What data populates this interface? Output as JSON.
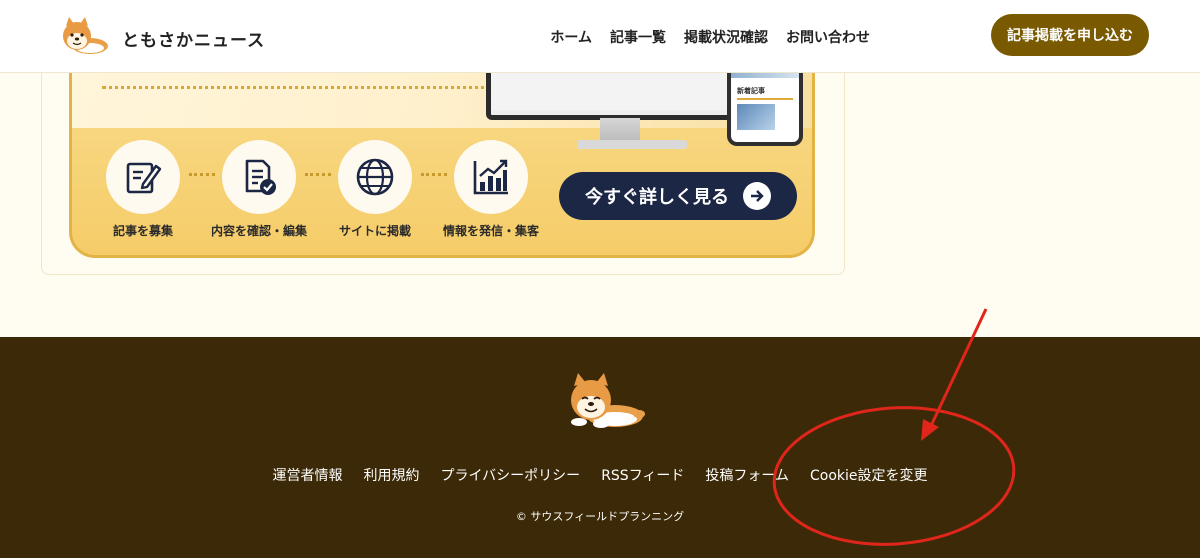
{
  "header": {
    "site_title": "ともさかニュース",
    "nav": [
      "ホーム",
      "記事一覧",
      "掲載状況確認",
      "お問い合わせ"
    ],
    "cta_label": "記事掲載を申し込む",
    "cta_color": "#7a5a00"
  },
  "banner": {
    "phone_label": "新着記事",
    "steps": [
      {
        "label": "記事を募集",
        "icon": "pen-note-icon"
      },
      {
        "label": "内容を確認・編集",
        "icon": "document-check-icon"
      },
      {
        "label": "サイトに掲載",
        "icon": "globe-icon"
      },
      {
        "label": "情報を発信・集客",
        "icon": "growth-chart-icon"
      }
    ],
    "more_button_label": "今すぐ詳しく見る",
    "more_button_color": "#1c2645"
  },
  "footer": {
    "links": [
      "運営者情報",
      "利用規約",
      "プライバシーポリシー",
      "RSSフィード",
      "投稿フォーム",
      "Cookie設定を変更"
    ],
    "copyright": "© サウスフィールドプランニング",
    "background": "#3b2907"
  },
  "annotation": {
    "color": "#e0261b",
    "target": "Cookie設定を変更"
  }
}
